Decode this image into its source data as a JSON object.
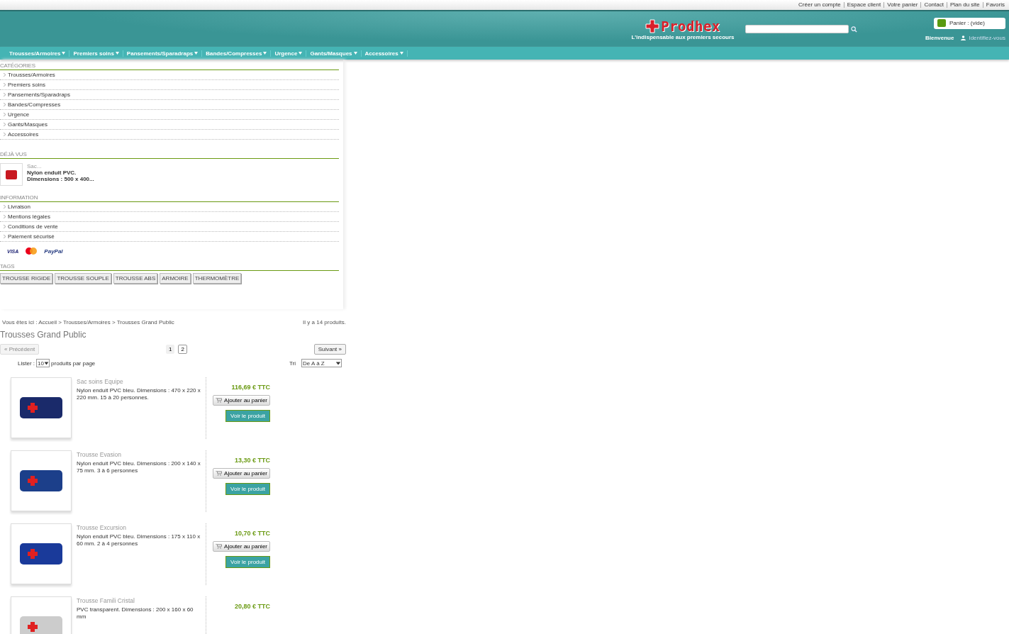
{
  "top_links": [
    "Créer un compte",
    "Espace client",
    "Votre panier",
    "Contact",
    "Plan du site",
    "Favoris"
  ],
  "logo": {
    "name": "Prodhex",
    "tagline": "L'indispensable aux premiers secours"
  },
  "cart": {
    "label": "Panier : (vide)"
  },
  "welcome": "Bienvenue",
  "login": "Identifiez-vous",
  "nav": [
    "Trousses/Armoires",
    "Premiers soins",
    "Pansements/Sparadraps",
    "Bandes/Compresses",
    "Urgence",
    "Gants/Masques",
    "Accessoires"
  ],
  "categories": {
    "title": "CATÉGORIES",
    "items": [
      "Trousses/Armoires",
      "Premiers soins",
      "Pansements/Sparadraps",
      "Bandes/Compresses",
      "Urgence",
      "Gants/Masques",
      "Accessoires"
    ]
  },
  "viewed": {
    "title": "DÉJÀ VUS",
    "name": "Sac...",
    "description": "Nylon enduit PVC. Dimensions : 500 x 400..."
  },
  "information": {
    "title": "INFORMATION",
    "items": [
      "Livraison",
      "Mentions légales",
      "Conditions de vente",
      "Paiement sécurisé"
    ]
  },
  "payment": [
    "VISA",
    "PayPal"
  ],
  "tags": {
    "title": "TAGS",
    "items": [
      "TROUSSE RIGIDE",
      "TROUSSE SOUPLE",
      "TROUSSE ABS",
      "ARMOIRE",
      "THERMOMÈTRE"
    ]
  },
  "breadcrumb": {
    "label": "Vous êtes ici :",
    "path": "Accueil > Trousses/Armoires > Trousses Grand Public"
  },
  "count": "Il y a 14 produits.",
  "heading": "Trousses Grand Public",
  "pagination": {
    "prev": {
      "label": "« Précédent",
      "disabled": true
    },
    "pages": [
      {
        "label": "1",
        "selected": true
      },
      {
        "label": "2",
        "selected": false
      }
    ],
    "next": {
      "label": "Suivant »",
      "disabled": false
    }
  },
  "per_page": {
    "label": "Lister :",
    "value": "10",
    "suffix": "produits par page"
  },
  "sort": {
    "label": "Tri",
    "value": "De A à Z"
  },
  "products": [
    {
      "name": "Sac soins Equipe",
      "description": "Nylon enduit PVC bleu. Dimensions : 470 x 220 x 220 mm. 15 à 20 personnes.",
      "price": "116,69 € TTC",
      "add": "Ajouter au panier",
      "view": "Voir le produit"
    },
    {
      "name": "Trousse Evasion",
      "description": "Nylon enduit PVC bleu. Dimensions : 200 x 140 x 75 mm. 3 à 6 personnes",
      "price": "13,30 € TTC",
      "add": "Ajouter au panier",
      "view": "Voir le produit"
    },
    {
      "name": "Trousse Excursion",
      "description": "Nylon enduit PVC bleu. Dimensions : 175 x 110 x 60 mm. 2 à 4 personnes",
      "price": "10,70 € TTC",
      "add": "Ajouter au panier",
      "view": "Voir le produit"
    },
    {
      "name": "Trousse Famili Cristal",
      "description": "PVC transparent. Dimensions : 200 x 160 x 60 mm",
      "price": "20,80 € TTC"
    }
  ]
}
